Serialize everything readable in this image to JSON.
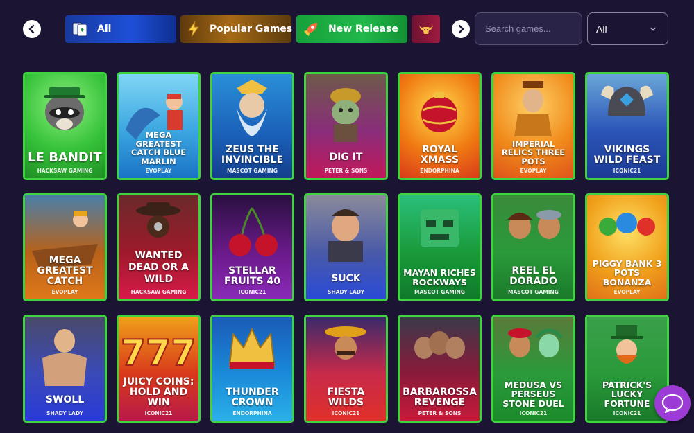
{
  "categories": [
    {
      "label": "All",
      "icon": "cards-icon"
    },
    {
      "label": "Popular Games",
      "icon": "lightning-icon"
    },
    {
      "label": "New Release",
      "icon": "rocket-icon"
    },
    {
      "label": "",
      "icon": "bull-icon"
    }
  ],
  "search": {
    "placeholder": "Search games..."
  },
  "filter": {
    "selected": "All"
  },
  "games": [
    {
      "title": "LE BANDIT",
      "provider": "HACKSAW GAMING"
    },
    {
      "title": "MEGA GREATEST CATCH BLUE MARLIN",
      "provider": "EVOPLAY"
    },
    {
      "title": "ZEUS THE INVINCIBLE",
      "provider": "MASCOT GAMING"
    },
    {
      "title": "DIG IT",
      "provider": "PETER & SONS"
    },
    {
      "title": "ROYAL XMASS",
      "provider": "ENDORPHINA"
    },
    {
      "title": "IMPERIAL RELICS THREE POTS",
      "provider": "EVOPLAY"
    },
    {
      "title": "VIKINGS WILD FEAST",
      "provider": "ICONIC21"
    },
    {
      "title": "MEGA GREATEST CATCH",
      "provider": "EVOPLAY"
    },
    {
      "title": "WANTED DEAD OR A WILD",
      "provider": "HACKSAW GAMING"
    },
    {
      "title": "STELLAR FRUITS 40",
      "provider": "ICONIC21"
    },
    {
      "title": "SUCK",
      "provider": "SHADY LADY"
    },
    {
      "title": "MAYAN RICHES ROCKWAYS",
      "provider": "MASCOT GAMING"
    },
    {
      "title": "REEL EL DORADO",
      "provider": "MASCOT GAMING"
    },
    {
      "title": "PIGGY BANK 3 POTS BONANZA",
      "provider": "EVOPLAY"
    },
    {
      "title": "SWOLL",
      "provider": "SHADY LADY"
    },
    {
      "title": "JUICY COINS: HOLD AND WIN",
      "provider": "ICONIC21"
    },
    {
      "title": "THUNDER CROWN",
      "provider": "ENDORPHINA"
    },
    {
      "title": "FIESTA WILDS",
      "provider": "ICONIC21"
    },
    {
      "title": "BARBAROSSA REVENGE",
      "provider": "PETER & SONS"
    },
    {
      "title": "MEDUSA VS PERSEUS STONE DUEL",
      "provider": "ICONIC21"
    },
    {
      "title": "PATRICK'S LUCKY FORTUNE",
      "provider": "ICONIC21"
    }
  ],
  "colors": {
    "background": "#1c1433",
    "card_border": "#3fd33f",
    "chat": "#9c3bd6"
  }
}
